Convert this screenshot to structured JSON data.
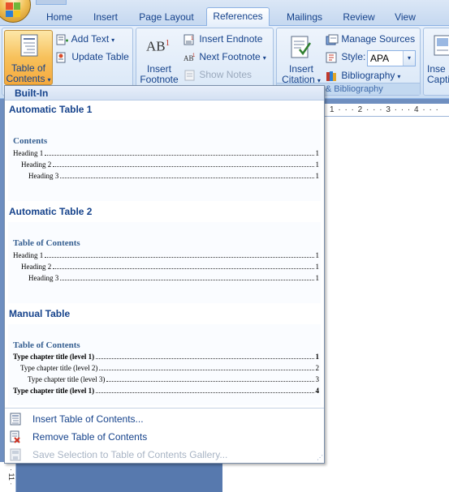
{
  "tabs": [
    "Home",
    "Insert",
    "Page Layout",
    "References",
    "Mailings",
    "Review",
    "View"
  ],
  "active_tab": "References",
  "ribbon": {
    "toc_group": {
      "toc_button": [
        "Table of",
        "Contents"
      ],
      "add_text": "Add Text",
      "update_table": "Update Table"
    },
    "footnotes_group": {
      "insert_footnote": [
        "Insert",
        "Footnote"
      ],
      "footnote_glyph": "AB",
      "footnote_sup": "1",
      "insert_endnote": "Insert Endnote",
      "next_footnote": "Next Footnote",
      "show_notes": "Show Notes"
    },
    "citations_group": {
      "insert_citation": [
        "Insert",
        "Citation"
      ],
      "manage_sources": "Manage Sources",
      "style_label": "Style:",
      "style_value": "APA",
      "bibliography": "Bibliography",
      "group_label": "ns & Bibliography"
    },
    "captions_group": {
      "insert_caption": [
        "Inse",
        "Captio"
      ]
    }
  },
  "ruler_text": "1 · · · 2 · · · 3 · · · 4 · · ·",
  "vruler_text": "· 11 ·",
  "gallery": {
    "header": "Built-In",
    "entries": [
      {
        "title": "Automatic Table 1",
        "heading": "Contents",
        "lines": [
          {
            "text": "Heading 1",
            "page": "1",
            "bold": false
          },
          {
            "text": "Heading 2",
            "page": "1",
            "bold": false
          },
          {
            "text": "Heading 3",
            "page": "1",
            "bold": false
          }
        ]
      },
      {
        "title": "Automatic Table 2",
        "heading": "Table of Contents",
        "lines": [
          {
            "text": "Heading 1",
            "page": "1",
            "bold": false
          },
          {
            "text": "Heading 2",
            "page": "1",
            "bold": false
          },
          {
            "text": "Heading 3",
            "page": "1",
            "bold": false
          }
        ]
      },
      {
        "title": "Manual Table",
        "heading": "Table of Contents",
        "lines": [
          {
            "text": "Type chapter title (level 1)",
            "page": "1",
            "bold": true
          },
          {
            "text": "Type chapter title (level 2)",
            "page": "2",
            "bold": false
          },
          {
            "text": "Type chapter title (level 3)",
            "page": "3",
            "bold": false
          },
          {
            "text": "Type chapter title (level 1)",
            "page": "4",
            "bold": true
          }
        ]
      }
    ],
    "menu": {
      "insert_toc": "Insert Table of Contents...",
      "remove_toc": "Remove Table of Contents",
      "save_selection": "Save Selection to Table of Contents Gallery..."
    }
  },
  "colors": {
    "ribbon_text": "#15428b",
    "pressed_button": "#f7c15b",
    "toc_heading": "#365f91",
    "document_background": "#5779ae"
  }
}
